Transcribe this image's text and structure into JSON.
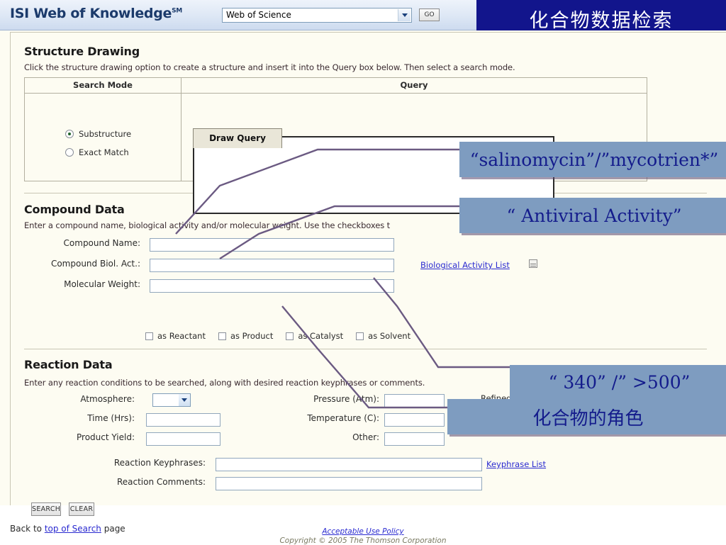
{
  "header": {
    "brand": "ISI Web of Knowledge",
    "brand_sm": "SM",
    "database_selected": "Web of Science",
    "go_label": "GO"
  },
  "banner": {
    "title": "化合物数据检索"
  },
  "structure_drawing": {
    "title": "Structure Drawing",
    "description": "Click the structure drawing option to create a structure and insert it into the Query box below. Then select a search mode.",
    "table_headers": [
      "Search Mode",
      "Query"
    ],
    "search_modes": [
      {
        "label": "Substructure",
        "selected": true
      },
      {
        "label": "Exact Match",
        "selected": false
      }
    ],
    "draw_query_tab": "Draw Query",
    "query_value": ""
  },
  "compound_data": {
    "title": "Compound Data",
    "description": "Enter a compound name, biological activity and/or molecular weight. Use the checkboxes t",
    "fields": [
      {
        "label": "Compound Name:",
        "value": ""
      },
      {
        "label": "Compound Biol. Act.:",
        "value": ""
      },
      {
        "label": "Molecular Weight:",
        "value": ""
      }
    ],
    "bio_activity_link": "Biological Activity List",
    "checkboxes": [
      {
        "label": "as Reactant",
        "checked": false
      },
      {
        "label": "as Product",
        "checked": false
      },
      {
        "label": "as Catalyst",
        "checked": false
      },
      {
        "label": "as Solvent",
        "checked": false
      }
    ]
  },
  "reaction_data": {
    "title": "Reaction Data",
    "description": "Enter any reaction conditions to be searched, along with desired reaction keyphrases or comments.",
    "left_fields": [
      {
        "label": "Atmosphere:",
        "value": ""
      },
      {
        "label": "Time (Hrs):",
        "value": ""
      },
      {
        "label": "Product Yield:",
        "value": ""
      }
    ],
    "right_fields": [
      {
        "label": "Pressure (Atm):",
        "value": ""
      },
      {
        "label": "Temperature (C):",
        "value": ""
      },
      {
        "label": "Other:",
        "value": ""
      }
    ],
    "refined_flag_label": "Refined Flag",
    "refined_flag_checked": false,
    "keyphrase_fields": [
      {
        "label": "Reaction Keyphrases:",
        "value": ""
      },
      {
        "label": "Reaction Comments:",
        "value": ""
      }
    ],
    "keyphrase_link": "Keyphrase List"
  },
  "actions": {
    "search_label": "SEARCH",
    "clear_label": "CLEAR",
    "back_prefix": "Back to ",
    "back_link": "top of Search",
    "back_suffix": " page"
  },
  "footer": {
    "policy_link": "Acceptable Use Policy",
    "copyright": "Copyright © 2005 The Thomson Corporation"
  },
  "callouts": [
    {
      "text": "“salinomycin”/”mycotrien*”"
    },
    {
      "text": "“ Antiviral Activity”"
    },
    {
      "text": "“ 340” /” >500”"
    },
    {
      "text": "化合物的角色"
    }
  ],
  "colors": {
    "banner_blue": "#12158c",
    "banner_underline": "#9e4a52",
    "callout_fill": "#7e9cc0",
    "callout_text": "#141c8c",
    "page_bg": "#fdfcf2",
    "link": "#2a2ad0",
    "connector": "#6b5a82"
  }
}
